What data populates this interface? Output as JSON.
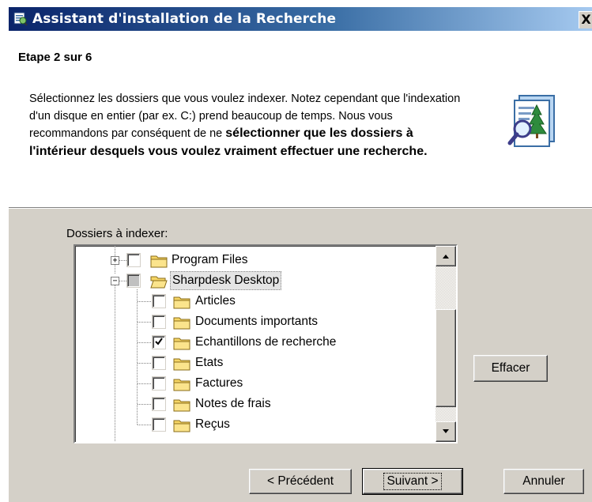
{
  "window": {
    "title": "Assistant d'installation de la Recherche",
    "close_label": "X"
  },
  "header": {
    "step": "Etape 2 sur 6",
    "description_plain": "Sélectionnez les dossiers que vous voulez indexer. Notez cependant que l'indexation d'un disque en entier (par ex. C:) prend beaucoup de temps. Nous vous recommandons par conséquent de ne",
    "description_bold": "sélectionner que les dossiers à l'intérieur desquels vous voulez vraiment effectuer une recherche.",
    "icon": "search-document-icon"
  },
  "folders": {
    "label": "Dossiers à indexer:",
    "tree": [
      {
        "name": "Program Files",
        "level": 0,
        "expander": "+",
        "checked": false
      },
      {
        "name": "Sharpdesk Desktop",
        "level": 0,
        "expander": "-",
        "checked": "partial",
        "open": true,
        "selected": true
      },
      {
        "name": "Articles",
        "level": 1,
        "checked": false
      },
      {
        "name": "Documents importants",
        "level": 1,
        "checked": false
      },
      {
        "name": "Echantillons de recherche",
        "level": 1,
        "checked": true
      },
      {
        "name": "Etats",
        "level": 1,
        "checked": false
      },
      {
        "name": "Factures",
        "level": 1,
        "checked": false
      },
      {
        "name": "Notes de frais",
        "level": 1,
        "checked": false
      },
      {
        "name": "Reçus",
        "level": 1,
        "checked": false
      }
    ]
  },
  "buttons": {
    "clear": "Effacer",
    "previous": "< Précédent",
    "next": "Suivant >",
    "cancel": "Annuler"
  },
  "colors": {
    "titlebar_start": "#0a246a",
    "titlebar_end": "#a6caf0",
    "face": "#d4d0c8",
    "folder": "#f5d565"
  }
}
